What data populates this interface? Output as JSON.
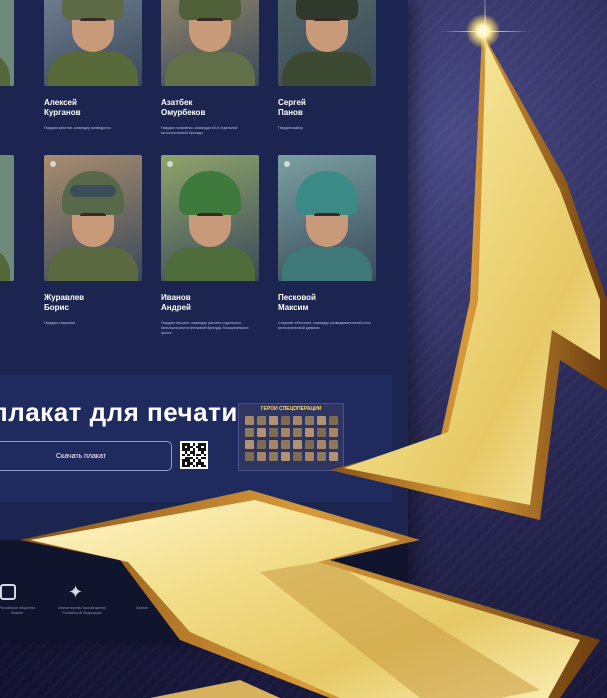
{
  "heroes": [
    {
      "name_line1": "Алексей",
      "name_line2": "Курганов",
      "desc": "Гвардии капитан, командир разведроты",
      "palette": {
        "bg": "#7d8a9e",
        "helmet": "#5c6b45",
        "body": "#58693a"
      }
    },
    {
      "name_line1": "Азатбек",
      "name_line2": "Омурбеков",
      "desc": "Гвардии полковник, командир 64-й отдельной мотострелковой бригады",
      "palette": {
        "bg": "#a7936f",
        "helmet": "#4f5f38",
        "body": "#62704a"
      }
    },
    {
      "name_line1": "Сергей",
      "name_line2": "Панов",
      "desc": "Гвардии майор",
      "palette": {
        "bg": "#5a6f68",
        "helmet": "#2f3a2c",
        "body": "#3c4a34"
      }
    },
    {
      "name_line1": "Журавлев",
      "name_line2": "Борис",
      "desc": "Гвардии старшина",
      "palette": {
        "bg": "#a88c6e",
        "helmet": "#58694a",
        "body": "#5b6a40"
      }
    },
    {
      "name_line1": "Иванов",
      "name_line2": "Андрей",
      "desc": "Гвардии сержант, командир расчета отдельного батальона мотострелковой бригады Тихоокеанского флота",
      "palette": {
        "bg": "#8fa46a",
        "helmet": "#3e7a3c",
        "body": "#4f6d3a"
      }
    },
    {
      "name_line1": "Песковой",
      "name_line2": "Максим",
      "desc": "Старший лейтенант, командир разведывательной роты мотострелковой дивизии",
      "palette": {
        "bg": "#7aa0a2",
        "helmet": "#3b8a86",
        "body": "#3f7878"
      }
    }
  ],
  "print_section": {
    "title": "плакат для печати",
    "download_label": "Скачать плакат",
    "poster_heading": "ГЕРОИ СПЕЦОПЕРАЦИИ"
  },
  "footer": {
    "org1": "Российское общество Знание",
    "org2": "Министерство просвещения Российской Федерации",
    "org3": "Знание"
  },
  "colors": {
    "page_bg": "#1b2550",
    "accent_gold": "#e8c65a",
    "backdrop": "#2c2c5a"
  }
}
